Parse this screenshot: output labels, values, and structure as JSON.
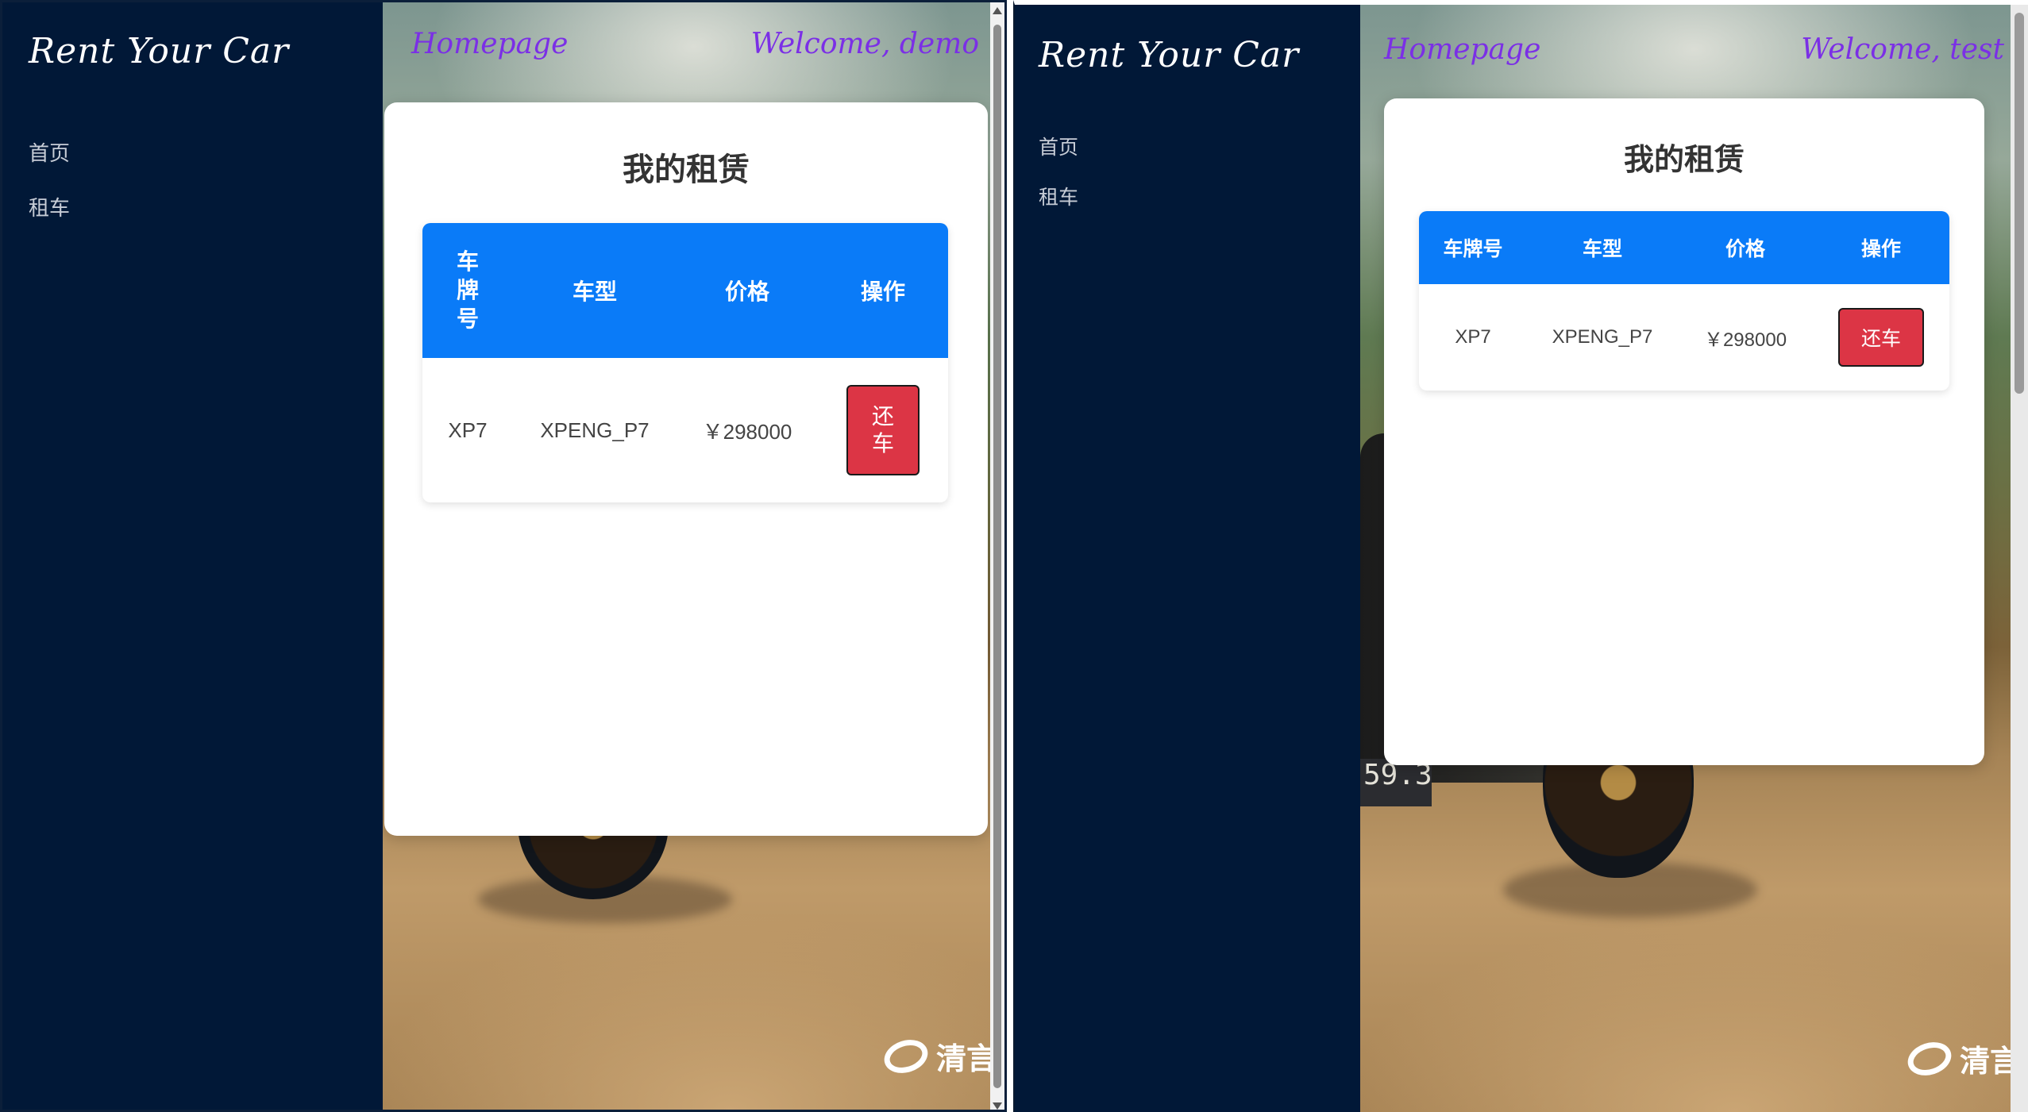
{
  "left_window": {
    "logo": "Rent Your Car",
    "nav": [
      "首页",
      "租车"
    ],
    "header": {
      "home_link": "Homepage",
      "welcome": "Welcome, demo"
    },
    "card": {
      "title": "我的租赁",
      "columns": [
        "车牌号",
        "车型",
        "价格",
        "操作"
      ],
      "rows": [
        {
          "plate": "XP7",
          "model": "XPENG_P7",
          "price": "￥298000",
          "action": "还车"
        }
      ]
    },
    "watermark": "清言"
  },
  "right_window": {
    "logo": "Rent Your Car",
    "nav": [
      "首页",
      "租车"
    ],
    "header": {
      "home_link": "Homepage",
      "welcome": "Welcome, test"
    },
    "card": {
      "title": "我的租赁",
      "columns": [
        "车牌号",
        "车型",
        "价格",
        "操作"
      ],
      "rows": [
        {
          "plate": "XP7",
          "model": "XPENG_P7",
          "price": "￥298000",
          "action": "还车"
        }
      ]
    },
    "watermark": "清言",
    "plate_text": "59.3"
  },
  "colors": {
    "sidebar": "#011837",
    "header_link": "#7b2fe6",
    "table_header": "#0a7bf8",
    "return_button": "#dc3545"
  }
}
